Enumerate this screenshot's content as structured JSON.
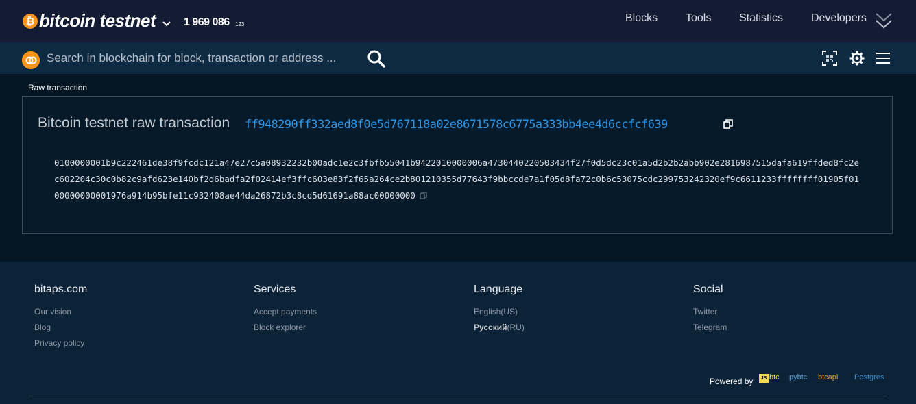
{
  "header": {
    "logo_symbol": "₿",
    "brand": "bitcoin testnet",
    "block_height": "1 969 086",
    "block_height_suffix": "123",
    "nav": [
      "Blocks",
      "Tools",
      "Statistics",
      "Developers"
    ]
  },
  "search": {
    "placeholder": "Search in blockchain for block, transaction or address ..."
  },
  "breadcrumb": "Raw transaction",
  "transaction": {
    "title": "Bitcoin testnet raw transaction",
    "hash": "ff948290ff332aed8f0e5d767118a02e8671578c6775a333bb4ee4d6ccfcf639",
    "raw_hex": "0100000001b9c222461de38f9fcdc121a47e27c5a08932232b00adc1e2c3fbfb55041b9422010000006a4730440220503434f27f0d5dc23c01a5d2b2b2abb902e2816987515dafa619ffded8fc2ec602204c30c0b82c9afd623e140bf2d6badfa2f02414ef3ffc603e83f2f65a264ce2b801210355d77643f9bbccde7a1f05d8fa72c0b6c53075cdc299753242320ef9c6611233ffffffff01905f0100000000001976a914b95bfe11c932408ae44da26872b3c8cd5d61691a88ac00000000"
  },
  "footer": {
    "columns": [
      {
        "title": "bitaps.com",
        "links": [
          "Our vision",
          "Blog",
          "Privacy policy"
        ]
      },
      {
        "title": "Services",
        "links": [
          "Accept payments",
          "Block explorer"
        ]
      },
      {
        "title": "Language",
        "links": [
          "English(US)",
          "Русский(RU)"
        ]
      },
      {
        "title": "Social",
        "links": [
          "Twitter",
          "Telegram"
        ]
      }
    ],
    "powered_by": "Powered by",
    "tech": {
      "js_badge": "JS",
      "jsbtc": "btc",
      "pybtc": "pybtc",
      "btcapi": "btcapi",
      "postgres": "Postgres"
    }
  },
  "colors": {
    "accent": "#2e97e8",
    "bitcoin_orange": "#f7931a",
    "topbar": "#141c33",
    "searchbar": "#0e2a42"
  }
}
